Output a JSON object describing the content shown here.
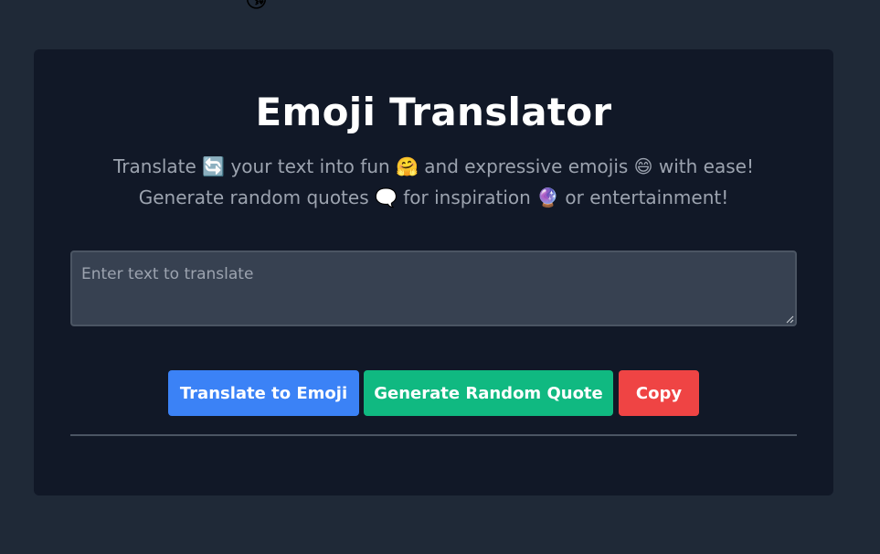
{
  "decor": {
    "top_emoji": "😘"
  },
  "header": {
    "title": "Emoji Translator"
  },
  "subtitle": {
    "line1": [
      {
        "text": "Translate "
      },
      {
        "emoji": "🔄"
      },
      {
        "text": " your text into fun "
      },
      {
        "emoji": "🤗"
      },
      {
        "text": " and expressive emojis "
      },
      {
        "emoji": "😄"
      },
      {
        "text": " with ease!"
      }
    ],
    "line2": [
      {
        "text": "Generate random quotes "
      },
      {
        "emoji": "🗨️"
      },
      {
        "text": " for inspiration "
      },
      {
        "emoji": "🔮"
      },
      {
        "text": " or entertainment!"
      }
    ]
  },
  "input": {
    "placeholder": "Enter text to translate",
    "value": ""
  },
  "buttons": {
    "translate_label": "Translate to Emoji",
    "quote_label": "Generate Random Quote",
    "copy_label": "Copy"
  },
  "colors": {
    "page_bg": "#1f2937",
    "card_bg": "#111827",
    "translate_btn": "#3b82f6",
    "quote_btn": "#10b981",
    "copy_btn": "#ef4444"
  }
}
